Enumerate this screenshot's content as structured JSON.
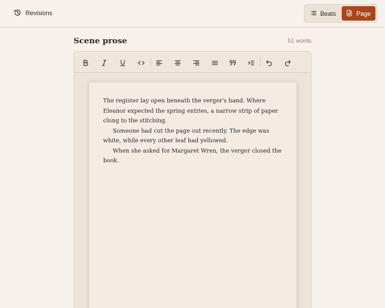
{
  "topbar": {
    "revisions_label": "Revisions",
    "view_toggle": {
      "beats_label": "Beats",
      "page_label": "Page",
      "active": "Page"
    }
  },
  "section": {
    "title": "Scene prose",
    "word_count": "51 words"
  },
  "toolbar": {
    "buttons": [
      "bold",
      "italic",
      "underline",
      "code",
      "align-left",
      "align-center",
      "align-right",
      "align-justify",
      "blockquote",
      "indent",
      "undo",
      "redo"
    ]
  },
  "prose": {
    "paragraphs": [
      "The register lay open beneath the verger's hand. Where Eleanor expected the spring entries, a narrow strip of paper clung to the stitching.",
      "Someone had cut the page out recently. The edge was white, while every other leaf had yellowed.",
      "When she asked for Margaret Wren, the verger closed the book."
    ]
  },
  "colors": {
    "accent": "#a8471e",
    "background": "#f6f1ea",
    "paper": "#f2ece3"
  }
}
